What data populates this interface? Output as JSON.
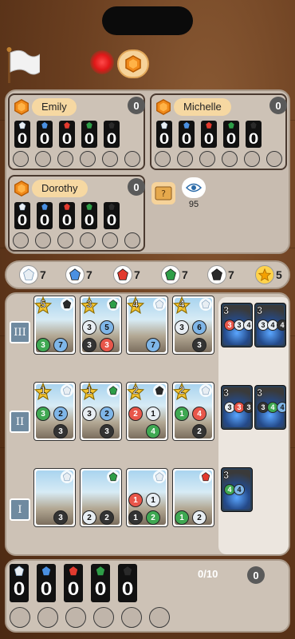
{
  "players": [
    {
      "name": "Emily",
      "points": "0",
      "gems": [
        "0",
        "0",
        "0",
        "0",
        "0"
      ]
    },
    {
      "name": "Michelle",
      "points": "0",
      "gems": [
        "0",
        "0",
        "0",
        "0",
        "0"
      ]
    },
    {
      "name": "Dorothy",
      "points": "0",
      "gems": [
        "0",
        "0",
        "0",
        "0",
        "0"
      ]
    }
  ],
  "spectators": "95",
  "bank": [
    {
      "gem": "white",
      "count": "7"
    },
    {
      "gem": "blue",
      "count": "7"
    },
    {
      "gem": "red",
      "count": "7"
    },
    {
      "gem": "green",
      "count": "7"
    },
    {
      "gem": "black",
      "count": "7"
    },
    {
      "gem": "gold",
      "count": "5"
    }
  ],
  "tiers": [
    "III",
    "II",
    "I"
  ],
  "cards": {
    "tier3": [
      {
        "points": "5",
        "bonus": "black",
        "cost": [
          [
            "green",
            "3"
          ],
          [
            "blue",
            "7"
          ]
        ]
      },
      {
        "points": "3",
        "bonus": "green",
        "cost": [
          [
            "white",
            "3"
          ],
          [
            "blue",
            "5"
          ],
          [
            "black",
            "3"
          ],
          [
            "red",
            "3"
          ]
        ]
      },
      {
        "points": "4",
        "bonus": "white",
        "cost": [
          [
            "blue",
            "7"
          ]
        ]
      },
      {
        "points": "4",
        "bonus": "white",
        "cost": [
          [
            "white",
            "3"
          ],
          [
            "blue",
            "6"
          ],
          [
            "black",
            "3"
          ]
        ]
      }
    ],
    "tier2": [
      {
        "points": "1",
        "bonus": "white",
        "cost": [
          [
            "green",
            "3"
          ],
          [
            "blue",
            "2"
          ],
          [
            "black",
            "3"
          ]
        ]
      },
      {
        "points": "1",
        "bonus": "green",
        "cost": [
          [
            "white",
            "3"
          ],
          [
            "blue",
            "2"
          ],
          [
            "black",
            "3"
          ]
        ]
      },
      {
        "points": "2",
        "bonus": "black",
        "cost": [
          [
            "red",
            "2"
          ],
          [
            "white",
            "1"
          ],
          [
            "green",
            "4"
          ]
        ]
      },
      {
        "points": "2",
        "bonus": "white",
        "cost": [
          [
            "green",
            "1"
          ],
          [
            "red",
            "4"
          ],
          [
            "black",
            "2"
          ]
        ]
      }
    ],
    "tier1": [
      {
        "points": "",
        "bonus": "white",
        "cost": [
          [
            "black",
            "3"
          ]
        ]
      },
      {
        "points": "",
        "bonus": "green",
        "cost": [
          [
            "white",
            "2"
          ],
          [
            "black",
            "2"
          ]
        ]
      },
      {
        "points": "",
        "bonus": "white",
        "cost": [
          [
            "red",
            "1"
          ],
          [
            "white",
            "1"
          ],
          [
            "black",
            "1"
          ],
          [
            "green",
            "2"
          ]
        ]
      },
      {
        "points": "",
        "bonus": "red",
        "cost": [
          [
            "green",
            "1"
          ],
          [
            "white",
            "2"
          ]
        ]
      }
    ]
  },
  "nobles": [
    {
      "points": "3",
      "cost": [
        [
          "red",
          "3"
        ],
        [
          "white",
          "3"
        ],
        [
          "white",
          "4"
        ]
      ]
    },
    {
      "points": "3",
      "cost": [
        [
          "white",
          "3"
        ],
        [
          "white",
          "4"
        ],
        [
          "black",
          "4"
        ]
      ]
    },
    {
      "points": "3",
      "cost": [
        [
          "white",
          "3"
        ],
        [
          "red",
          "3"
        ],
        [
          "black",
          "3"
        ]
      ]
    },
    {
      "points": "3",
      "cost": [
        [
          "black",
          "3"
        ],
        [
          "green",
          "4"
        ],
        [
          "blue",
          "4"
        ]
      ]
    },
    {
      "points": "3",
      "cost": [
        [
          "green",
          "4"
        ],
        [
          "blue",
          "4"
        ]
      ]
    }
  ],
  "self": {
    "gems": [
      "0",
      "0",
      "0",
      "0",
      "0"
    ],
    "reserved": "0/10",
    "points": "0"
  },
  "colors": {
    "white": "#e8eef3",
    "blue": "#4a90e2",
    "red": "#e23a2e",
    "green": "#2e9e48",
    "black": "#2a2a2a",
    "gold": "#f4b400"
  }
}
